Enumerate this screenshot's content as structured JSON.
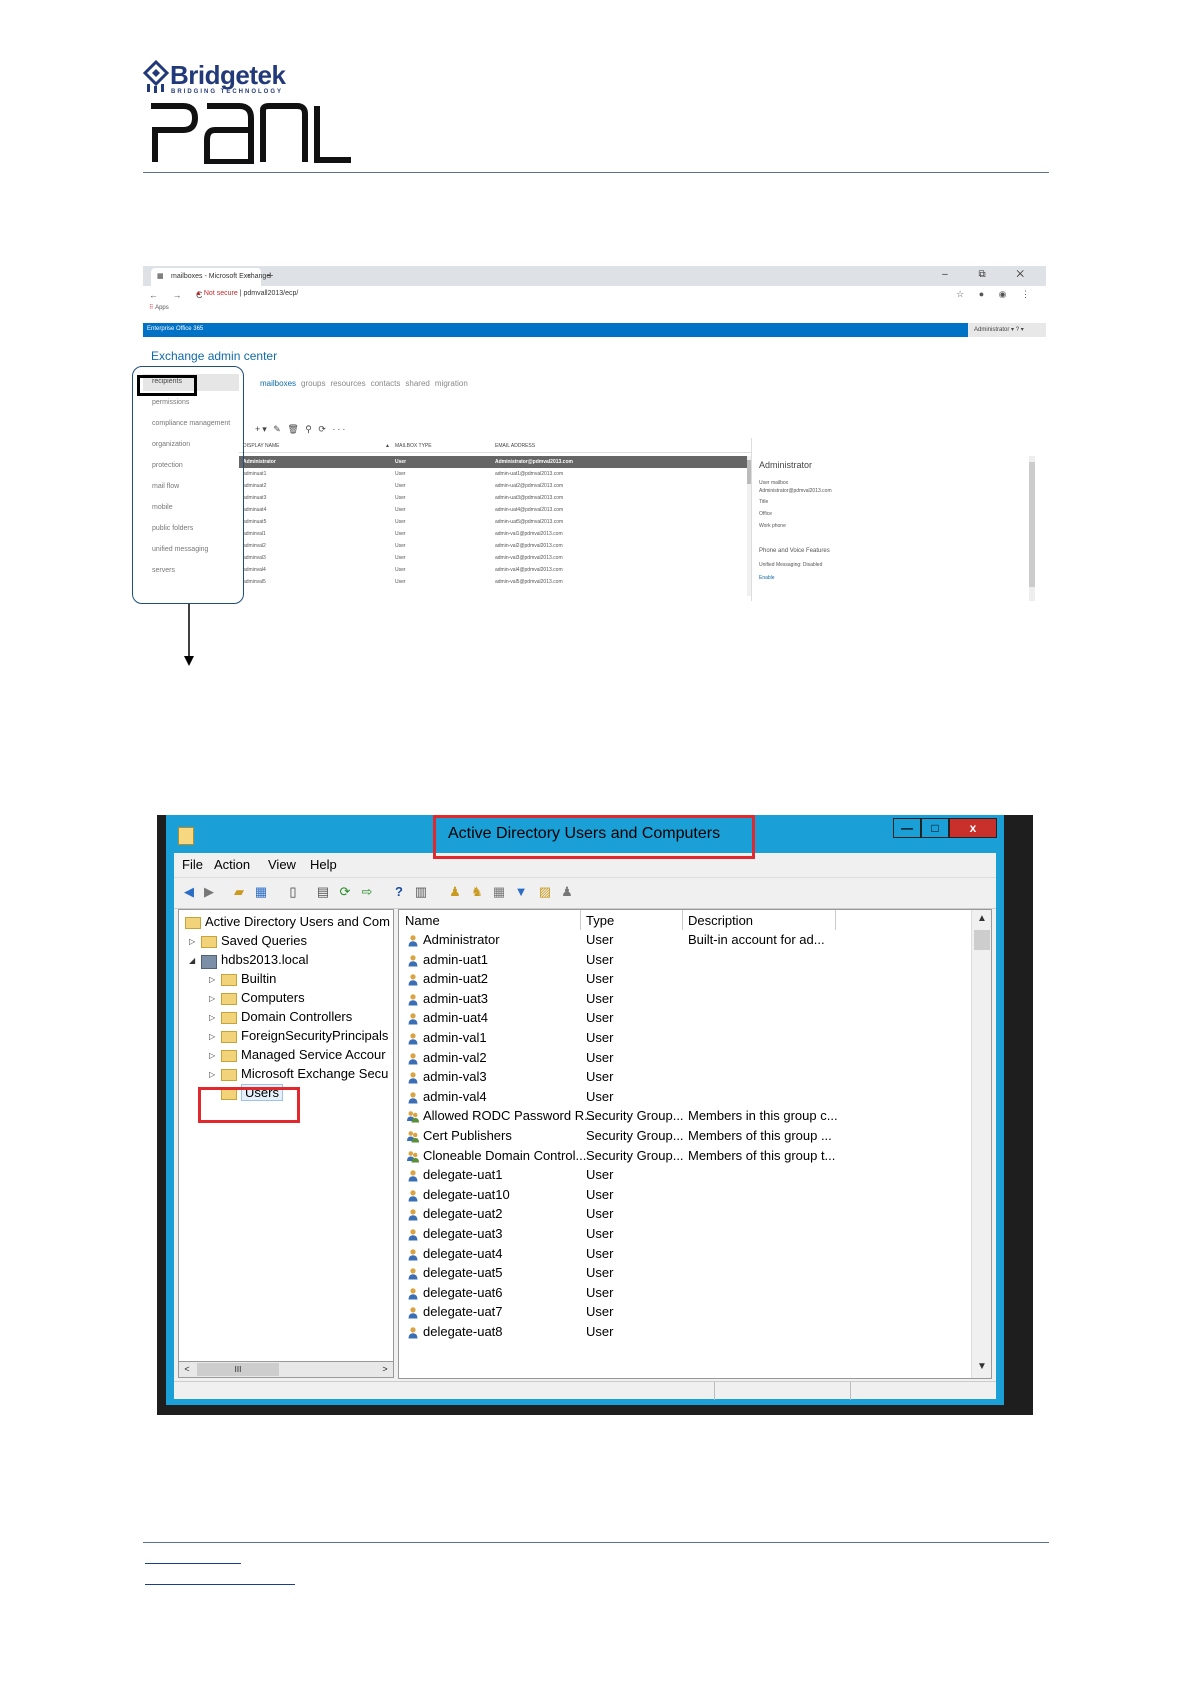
{
  "header": {
    "brand_name": "Bridgetek",
    "brand_tagline": "BRIDGING TECHNOLOGY",
    "product_logo": "PanL"
  },
  "browser": {
    "tab_title": "mailboxes - Microsoft Exchange",
    "tab_close": "×",
    "new_tab": "+",
    "window_controls": "–  ⧉  ✕",
    "nav_buttons": "← → C",
    "security_warning": "▲ Not secure",
    "url": "pdmvall2013/ecp/",
    "right_icons": "☆ ● ◉ ⋮",
    "apps_label": "Apps",
    "o365_bar": {
      "left_text": "Enterprise   Office 365",
      "account": "Administrator ▾   ? ▾"
    },
    "eac": {
      "title": "Exchange admin center",
      "nav": [
        "recipients",
        "permissions",
        "compliance management",
        "organization",
        "protection",
        "mail flow",
        "mobile",
        "public folders",
        "unified messaging",
        "servers"
      ],
      "tabs": [
        "mailboxes",
        "groups",
        "resources",
        "contacts",
        "shared",
        "migration"
      ],
      "toolbar": "+▾ ✎ 🗑 ⚲ ⟳ ···",
      "columns": [
        "DISPLAY NAME",
        "▲",
        "MAILBOX TYPE",
        "EMAIL ADDRESS"
      ],
      "rows": [
        {
          "name": "Administrator",
          "type": "User",
          "email": "Administrator@pdmval2013.com"
        },
        {
          "name": "adminuat1",
          "type": "User",
          "email": "admin-uat1@pdmval2013.com"
        },
        {
          "name": "adminuat2",
          "type": "User",
          "email": "admin-uat2@pdmval2013.com"
        },
        {
          "name": "adminuat3",
          "type": "User",
          "email": "admin-uat3@pdmval2013.com"
        },
        {
          "name": "adminuat4",
          "type": "User",
          "email": "admin-uat4@pdmval2013.com"
        },
        {
          "name": "adminuat5",
          "type": "User",
          "email": "admin-uat5@pdmval2013.com"
        },
        {
          "name": "adminval1",
          "type": "User",
          "email": "admin-val1@pdmval2013.com"
        },
        {
          "name": "adminval2",
          "type": "User",
          "email": "admin-val2@pdmval2013.com"
        },
        {
          "name": "adminval3",
          "type": "User",
          "email": "admin-val3@pdmval2013.com"
        },
        {
          "name": "adminval4",
          "type": "User",
          "email": "admin-val4@pdmval2013.com"
        },
        {
          "name": "adminval5",
          "type": "User",
          "email": "admin-val5@pdmval2013.com"
        }
      ],
      "details": {
        "title": "Administrator",
        "type": "User mailbox",
        "email": "Administrator@pdmval2013.com",
        "title_label": "Title",
        "office_label": "Office",
        "phone_label": "Work phone",
        "section": "Phone and Voice Features",
        "um": "Unified Messaging: Disabled",
        "enable": "Enable"
      }
    }
  },
  "ad_window": {
    "title": "Active Directory Users and Computers",
    "min": "—",
    "max": "□",
    "close": "x",
    "menu": [
      "File",
      "Action",
      "View",
      "Help"
    ],
    "tree": [
      {
        "label": "Active Directory Users and Com",
        "level": 0,
        "icon": "folder"
      },
      {
        "label": "Saved Queries",
        "level": 1,
        "icon": "folder",
        "expander": "▷"
      },
      {
        "label": "hdbs2013.local",
        "level": 1,
        "icon": "domain",
        "expander": "◢"
      },
      {
        "label": "Builtin",
        "level": 2,
        "icon": "folder",
        "expander": "▷"
      },
      {
        "label": "Computers",
        "level": 2,
        "icon": "folder",
        "expander": "▷"
      },
      {
        "label": "Domain Controllers",
        "level": 2,
        "icon": "folder",
        "expander": "▷"
      },
      {
        "label": "ForeignSecurityPrincipals",
        "level": 2,
        "icon": "folder",
        "expander": "▷"
      },
      {
        "label": "Managed Service Accour",
        "level": 2,
        "icon": "folder",
        "expander": "▷"
      },
      {
        "label": "Microsoft Exchange Secu",
        "level": 2,
        "icon": "folder",
        "expander": "▷"
      },
      {
        "label": "Users",
        "level": 2,
        "icon": "folder",
        "expander": ""
      }
    ],
    "tree_scroll": {
      "left": "<",
      "thumb": "III",
      "right": ">"
    },
    "columns": [
      "Name",
      "Type",
      "Description"
    ],
    "rows": [
      {
        "name": "Administrator",
        "type": "User",
        "desc": "Built-in account for ad...",
        "icon": "user"
      },
      {
        "name": "admin-uat1",
        "type": "User",
        "desc": "",
        "icon": "user"
      },
      {
        "name": "admin-uat2",
        "type": "User",
        "desc": "",
        "icon": "user"
      },
      {
        "name": "admin-uat3",
        "type": "User",
        "desc": "",
        "icon": "user"
      },
      {
        "name": "admin-uat4",
        "type": "User",
        "desc": "",
        "icon": "user"
      },
      {
        "name": "admin-val1",
        "type": "User",
        "desc": "",
        "icon": "user"
      },
      {
        "name": "admin-val2",
        "type": "User",
        "desc": "",
        "icon": "user"
      },
      {
        "name": "admin-val3",
        "type": "User",
        "desc": "",
        "icon": "user"
      },
      {
        "name": "admin-val4",
        "type": "User",
        "desc": "",
        "icon": "user"
      },
      {
        "name": "Allowed RODC Password R...",
        "type": "Security Group...",
        "desc": "Members in this group c...",
        "icon": "group"
      },
      {
        "name": "Cert Publishers",
        "type": "Security Group...",
        "desc": "Members of this group ...",
        "icon": "group"
      },
      {
        "name": "Cloneable Domain Control...",
        "type": "Security Group...",
        "desc": "Members of this group t...",
        "icon": "group"
      },
      {
        "name": "delegate-uat1",
        "type": "User",
        "desc": "",
        "icon": "user"
      },
      {
        "name": "delegate-uat10",
        "type": "User",
        "desc": "",
        "icon": "user"
      },
      {
        "name": "delegate-uat2",
        "type": "User",
        "desc": "",
        "icon": "user"
      },
      {
        "name": "delegate-uat3",
        "type": "User",
        "desc": "",
        "icon": "user"
      },
      {
        "name": "delegate-uat4",
        "type": "User",
        "desc": "",
        "icon": "user"
      },
      {
        "name": "delegate-uat5",
        "type": "User",
        "desc": "",
        "icon": "user"
      },
      {
        "name": "delegate-uat6",
        "type": "User",
        "desc": "",
        "icon": "user"
      },
      {
        "name": "delegate-uat7",
        "type": "User",
        "desc": "",
        "icon": "user"
      },
      {
        "name": "delegate-uat8",
        "type": "User",
        "desc": "",
        "icon": "user"
      }
    ],
    "list_scroll": {
      "up": "▲",
      "down": "▼"
    }
  },
  "colors": {
    "brand_blue": "#233a7a",
    "highlight_red": "#e0282d",
    "window_blue": "#1a9fd6",
    "o365_blue": "#0072c6"
  }
}
